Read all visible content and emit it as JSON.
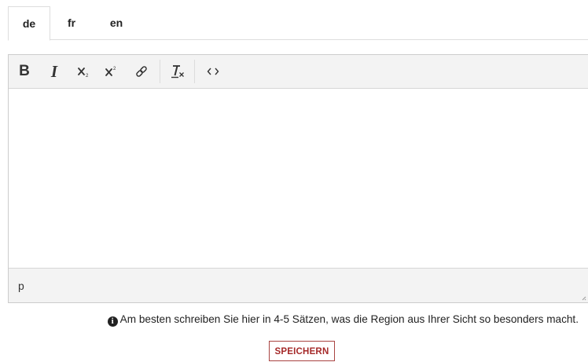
{
  "tabs": [
    {
      "label": "de",
      "active": true
    },
    {
      "label": "fr",
      "active": false
    },
    {
      "label": "en",
      "active": false
    }
  ],
  "toolbar": {
    "bold_label": "B",
    "italic_label": "I",
    "buttons": [
      {
        "name": "bold",
        "icon": "bold-icon"
      },
      {
        "name": "italic",
        "icon": "italic-icon"
      },
      {
        "name": "subscript",
        "icon": "subscript-icon"
      },
      {
        "name": "superscript",
        "icon": "superscript-icon"
      },
      {
        "name": "link",
        "icon": "link-icon"
      },
      {
        "name": "clear-formatting",
        "icon": "clear-formatting-icon"
      },
      {
        "name": "source-code",
        "icon": "code-icon"
      }
    ]
  },
  "editor": {
    "content": "",
    "path": "p"
  },
  "hint": {
    "icon": "info-icon",
    "text": "Am besten schreiben Sie hier in 4-5 Sätzen, was die Region aus Ihrer Sicht so besonders macht."
  },
  "save_button": {
    "label": "SPEICHERN"
  },
  "colors": {
    "toolbar_bg": "#f3f3f3",
    "border": "#cccccc",
    "save_accent": "#a94442"
  }
}
